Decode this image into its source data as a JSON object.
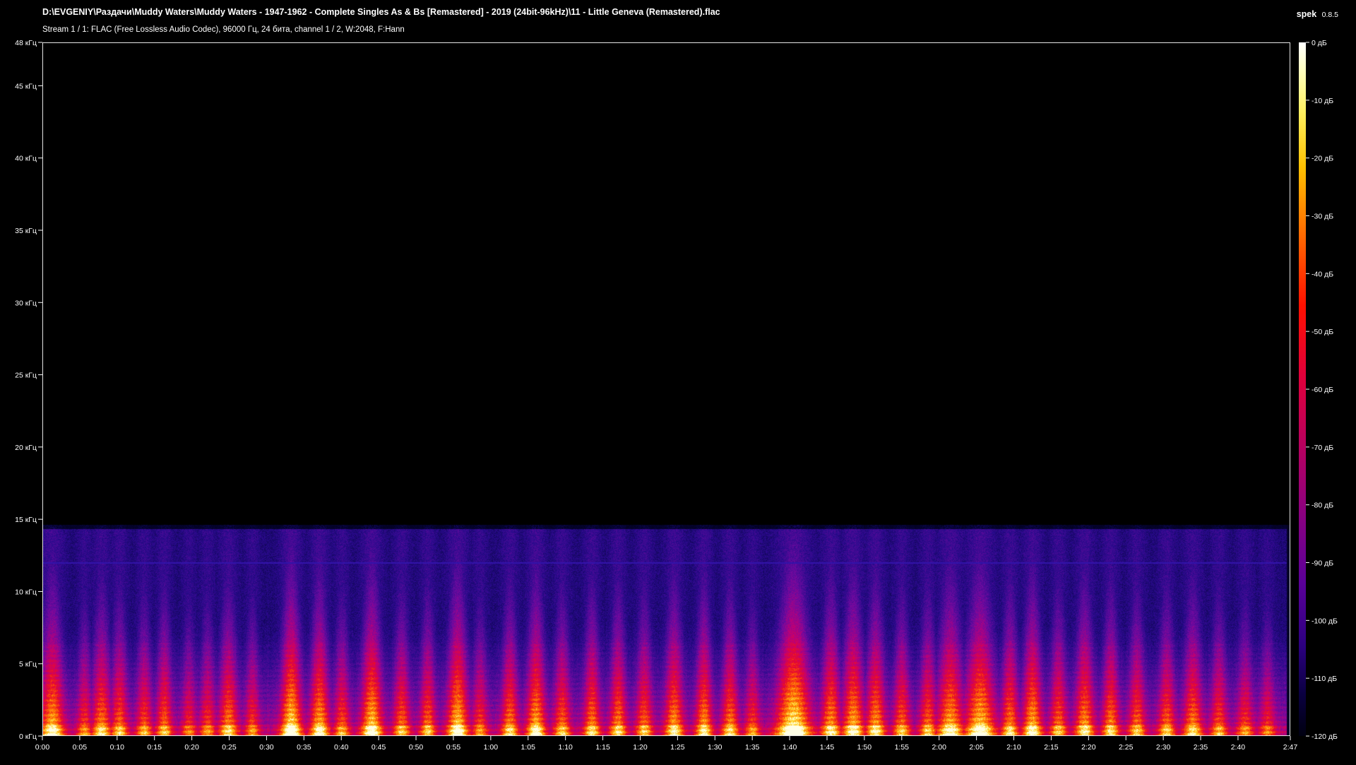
{
  "header": {
    "file_path": "D:\\EVGENIY\\Раздачи\\Muddy Waters\\Muddy Waters - 1947-1962 - Complete Singles As & Bs [Remastered] - 2019 (24bit-96kHz)\\11 - Little Geneva (Remastered).flac",
    "stream_info": "Stream 1 / 1: FLAC (Free Lossless Audio Codec), 96000 Гц, 24 бита, channel 1 / 2, W:2048, F:Hann",
    "app_name": "spek",
    "app_version": "0.8.5"
  },
  "frequency_axis": {
    "unit": "кГц",
    "labels": [
      "48 кГц",
      "45 кГц",
      "40 кГц",
      "35 кГц",
      "30 кГц",
      "25 кГц",
      "20 кГц",
      "15 кГц",
      "10 кГц",
      "5 кГц",
      "0 кГц"
    ],
    "values_khz": [
      48,
      45,
      40,
      35,
      30,
      25,
      20,
      15,
      10,
      5,
      0
    ],
    "max_khz": 48
  },
  "time_axis": {
    "labels": [
      "0:00",
      "0:05",
      "0:10",
      "0:15",
      "0:20",
      "0:25",
      "0:30",
      "0:35",
      "0:40",
      "0:45",
      "0:50",
      "0:55",
      "1:00",
      "1:05",
      "1:10",
      "1:15",
      "1:20",
      "1:25",
      "1:30",
      "1:35",
      "1:40",
      "1:45",
      "1:50",
      "1:55",
      "2:00",
      "2:05",
      "2:10",
      "2:15",
      "2:20",
      "2:25",
      "2:30",
      "2:35",
      "2:40",
      "2:47"
    ],
    "values_sec": [
      0,
      5,
      10,
      15,
      20,
      25,
      30,
      35,
      40,
      45,
      50,
      55,
      60,
      65,
      70,
      75,
      80,
      85,
      90,
      95,
      100,
      105,
      110,
      115,
      120,
      125,
      130,
      135,
      140,
      145,
      150,
      155,
      160,
      167
    ],
    "duration_sec": 167
  },
  "db_scale": {
    "labels": [
      "0 дБ",
      "-10 дБ",
      "-20 дБ",
      "-30 дБ",
      "-40 дБ",
      "-50 дБ",
      "-60 дБ",
      "-70 дБ",
      "-80 дБ",
      "-90 дБ",
      "-100 дБ",
      "-110 дБ",
      "-120 дБ"
    ],
    "values_db": [
      0,
      -10,
      -20,
      -30,
      -40,
      -50,
      -60,
      -70,
      -80,
      -90,
      -100,
      -110,
      -120
    ]
  },
  "spectrogram": {
    "audio_cutoff_khz": 14.3,
    "tone_line_khz": 12,
    "bursts": [
      {
        "t": 1.2,
        "w": 2.2,
        "amp": 0.85
      },
      {
        "t": 5.5,
        "w": 1.4,
        "amp": 0.6
      },
      {
        "t": 7.8,
        "w": 1.8,
        "amp": 0.75
      },
      {
        "t": 10.2,
        "w": 1.6,
        "amp": 0.7
      },
      {
        "t": 13.5,
        "w": 1.5,
        "amp": 0.65
      },
      {
        "t": 16.2,
        "w": 1.5,
        "amp": 0.7
      },
      {
        "t": 19.5,
        "w": 1.4,
        "amp": 0.55
      },
      {
        "t": 22.0,
        "w": 1.5,
        "amp": 0.6
      },
      {
        "t": 24.8,
        "w": 1.8,
        "amp": 0.75
      },
      {
        "t": 28.0,
        "w": 1.4,
        "amp": 0.6
      },
      {
        "t": 33.2,
        "w": 2.0,
        "amp": 0.95
      },
      {
        "t": 37.0,
        "w": 1.8,
        "amp": 0.85
      },
      {
        "t": 40.0,
        "w": 1.5,
        "amp": 0.65
      },
      {
        "t": 44.0,
        "w": 2.0,
        "amp": 0.9
      },
      {
        "t": 48.0,
        "w": 1.6,
        "amp": 0.7
      },
      {
        "t": 51.5,
        "w": 1.5,
        "amp": 0.7
      },
      {
        "t": 55.5,
        "w": 2.0,
        "amp": 0.9
      },
      {
        "t": 58.5,
        "w": 1.5,
        "amp": 0.6
      },
      {
        "t": 62.5,
        "w": 1.6,
        "amp": 0.75
      },
      {
        "t": 66.0,
        "w": 1.8,
        "amp": 0.85
      },
      {
        "t": 69.5,
        "w": 1.6,
        "amp": 0.7
      },
      {
        "t": 73.5,
        "w": 1.6,
        "amp": 0.75
      },
      {
        "t": 77.0,
        "w": 1.6,
        "amp": 0.75
      },
      {
        "t": 80.5,
        "w": 1.6,
        "amp": 0.7
      },
      {
        "t": 84.5,
        "w": 1.8,
        "amp": 0.8
      },
      {
        "t": 88.5,
        "w": 1.6,
        "amp": 0.8
      },
      {
        "t": 92.0,
        "w": 1.6,
        "amp": 0.75
      },
      {
        "t": 95.0,
        "w": 1.5,
        "amp": 0.6
      },
      {
        "t": 100.5,
        "w": 3.2,
        "amp": 1.0
      },
      {
        "t": 105.5,
        "w": 1.8,
        "amp": 0.8
      },
      {
        "t": 108.5,
        "w": 2.0,
        "amp": 0.85
      },
      {
        "t": 111.5,
        "w": 1.8,
        "amp": 0.8
      },
      {
        "t": 115.0,
        "w": 1.6,
        "amp": 0.7
      },
      {
        "t": 118.5,
        "w": 1.6,
        "amp": 0.7
      },
      {
        "t": 121.5,
        "w": 2.4,
        "amp": 0.85
      },
      {
        "t": 125.5,
        "w": 2.8,
        "amp": 0.9
      },
      {
        "t": 129.5,
        "w": 1.6,
        "amp": 0.75
      },
      {
        "t": 132.5,
        "w": 1.8,
        "amp": 0.85
      },
      {
        "t": 136.0,
        "w": 1.6,
        "amp": 0.7
      },
      {
        "t": 139.5,
        "w": 1.8,
        "amp": 0.8
      },
      {
        "t": 143.0,
        "w": 1.6,
        "amp": 0.75
      },
      {
        "t": 146.5,
        "w": 1.6,
        "amp": 0.7
      },
      {
        "t": 150.5,
        "w": 1.6,
        "amp": 0.7
      },
      {
        "t": 154.0,
        "w": 1.8,
        "amp": 0.75
      },
      {
        "t": 157.5,
        "w": 1.6,
        "amp": 0.65
      },
      {
        "t": 161.0,
        "w": 1.6,
        "amp": 0.6
      },
      {
        "t": 164.0,
        "w": 1.5,
        "amp": 0.55
      }
    ]
  }
}
